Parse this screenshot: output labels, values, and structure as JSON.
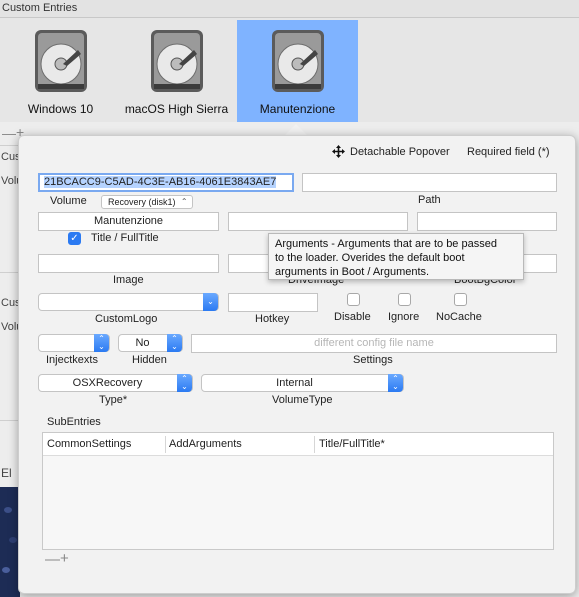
{
  "window": {
    "section_title": "Custom Entries"
  },
  "entries": [
    {
      "label": "Windows 10",
      "selected": false
    },
    {
      "label": "macOS High Sierra",
      "selected": false
    },
    {
      "label": "Manutenzione",
      "selected": true
    }
  ],
  "bg": {
    "minus": "—",
    "plus": "+",
    "cut1": "Cus",
    "cut2": "Volu",
    "cut3": "Cus",
    "cut4": "Volu",
    "cut5": "El"
  },
  "popover": {
    "detach_label": "Detachable Popover",
    "required_label": "Required field (*)",
    "uuid_value": "21BCACC9-C5AD-4C3E-AB16-4061E3843AE7",
    "volume_label": "Volume",
    "volume_selected": "Recovery (disk1)",
    "path_label": "Path",
    "title_value": "Manutenzione",
    "title_checkbox_label": "Title / FullTitle",
    "image_label": "Image",
    "driveimage_label": "DriveImage",
    "bootbg_label": "BootBgColor",
    "customlogo_label": "CustomLogo",
    "hotkey_label": "Hotkey",
    "disable_label": "Disable",
    "ignore_label": "Ignore",
    "nocache_label": "NoCache",
    "injectkexts_label": "Injectkexts",
    "hidden_value": "No",
    "hidden_label": "Hidden",
    "settings_placeholder": "different config file name",
    "settings_label": "Settings",
    "type_value": "OSXRecovery",
    "type_label": "Type*",
    "volumetype_value": "Internal",
    "volumetype_label": "VolumeType",
    "subentries_label": "SubEntries",
    "columns": [
      "CommonSettings",
      "AddArguments",
      "Title/FullTitle*"
    ],
    "table_minus": "—",
    "table_plus": "+"
  },
  "tooltip": {
    "line1": "Arguments - Arguments that are to be passed",
    "line2": "to the loader. Overides the default boot",
    "line3": "arguments in Boot / Arguments."
  },
  "colors": {
    "selection": "#7fb3ff",
    "accent": "#2b7af2"
  }
}
